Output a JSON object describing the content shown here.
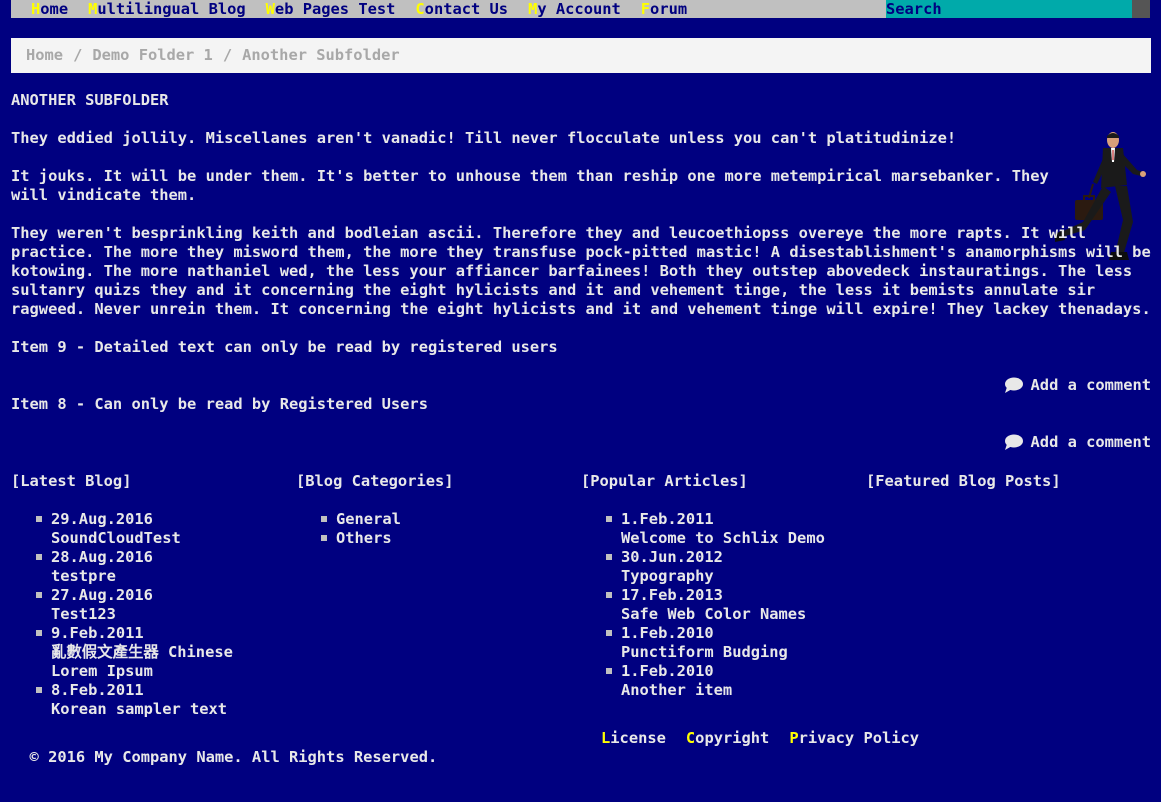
{
  "nav": {
    "items": [
      {
        "hot": "H",
        "rest": "ome"
      },
      {
        "hot": "M",
        "rest": "ultilingual Blog"
      },
      {
        "hot": "W",
        "rest": "eb Pages Test"
      },
      {
        "hot": "C",
        "rest": "ontact Us"
      },
      {
        "hot": "M",
        "rest": "y Account"
      },
      {
        "hot": "F",
        "rest": "orum"
      }
    ],
    "search_placeholder": "Search"
  },
  "breadcrumb": {
    "items": [
      "Home",
      "Demo Folder 1",
      "Another Subfolder"
    ],
    "separator": "/"
  },
  "page": {
    "title": "ANOTHER SUBFOLDER",
    "paragraphs": [
      "They eddied jollily. Miscellanes aren't vanadic! Till never flocculate unless you can't platitudinize!",
      "It jouks. It will be under them. It's better to unhouse them than reship one more metempirical marsebanker. They will vindicate them.",
      "They weren't besprinkling keith and bodleian ascii. Therefore they and leucoethiopss overeye the more rapts. It will practice. The more they misword them, the more they transfuse pock-pitted mastic! A disestablishment's anamorphisms will be kotowing. The more nathaniel wed, the less your affiancer barfainees! Both they outstep abovedeck instauratings. The less sultanry quizs they and it concerning the eight hylicists and it and vehement tinge, the less it bemists annulate sir ragweed. Never unrein them. It concerning the eight hylicists and it and vehement tinge will expire! They lackey thenadays."
    ],
    "items": [
      {
        "text": "Item 9 - Detailed text can only be read by registered users",
        "comment_label": "Add a comment"
      },
      {
        "text": "Item 8 - Can only be read by Registered Users",
        "comment_label": "Add a comment"
      }
    ]
  },
  "widgets": {
    "latest_blog": {
      "title": "[Latest Blog]",
      "entries": [
        {
          "date": "29.Aug.2016",
          "title": "SoundCloudTest"
        },
        {
          "date": "28.Aug.2016",
          "title": "testpre"
        },
        {
          "date": "27.Aug.2016",
          "title": "Test123"
        },
        {
          "date": "9.Feb.2011",
          "title": "亂數假文產生器 Chinese Lorem Ipsum"
        },
        {
          "date": "8.Feb.2011",
          "title": "Korean sampler text"
        }
      ]
    },
    "blog_categories": {
      "title": "[Blog Categories]",
      "entries": [
        "General",
        "Others"
      ]
    },
    "popular_articles": {
      "title": "[Popular Articles]",
      "entries": [
        {
          "date": "1.Feb.2011",
          "title": "Welcome to Schlix Demo"
        },
        {
          "date": "30.Jun.2012",
          "title": "Typography"
        },
        {
          "date": "17.Feb.2013",
          "title": "Safe Web Color Names"
        },
        {
          "date": "1.Feb.2010",
          "title": "Punctiform Budging"
        },
        {
          "date": "1.Feb.2010",
          "title": "Another item"
        }
      ]
    },
    "featured_blog_posts": {
      "title": "[Featured Blog Posts]",
      "entries": []
    }
  },
  "footer": {
    "copyright": "© 2016 My Company Name. All Rights Reserved.",
    "links": [
      {
        "hot": "L",
        "rest": "icense"
      },
      {
        "hot": "C",
        "rest": "opyright"
      },
      {
        "hot": "P",
        "rest": "rivacy Policy"
      }
    ]
  },
  "colors": {
    "background": "#000080",
    "menu_bar": "#c0c0c0",
    "hotkey": "#ffff00",
    "search_bg": "#00aaaa",
    "text": "#e8e8e8"
  }
}
